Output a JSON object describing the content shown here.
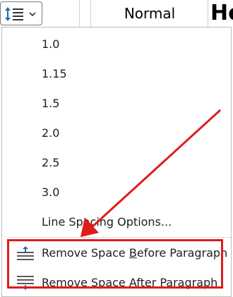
{
  "ribbon": {
    "styles": {
      "normal": "Normal",
      "heading_fragment": "He"
    }
  },
  "menu": {
    "spacing_options": [
      "1.0",
      "1.15",
      "1.5",
      "2.0",
      "2.5",
      "3.0"
    ],
    "options_label": "Line Spacing Options...",
    "remove_before": {
      "pre": "Remove Space ",
      "accel": "B",
      "post": "efore Paragraph"
    },
    "remove_after": {
      "pre": "Remove Space ",
      "accel": "A",
      "post": "fter Paragraph"
    }
  },
  "annotation": {
    "highlight_color": "#e01b1b"
  },
  "icons": {
    "line_spacing": "line-spacing-icon",
    "chevron": "chevron-down-icon",
    "remove_before": "remove-space-before-icon",
    "remove_after": "remove-space-after-icon"
  }
}
